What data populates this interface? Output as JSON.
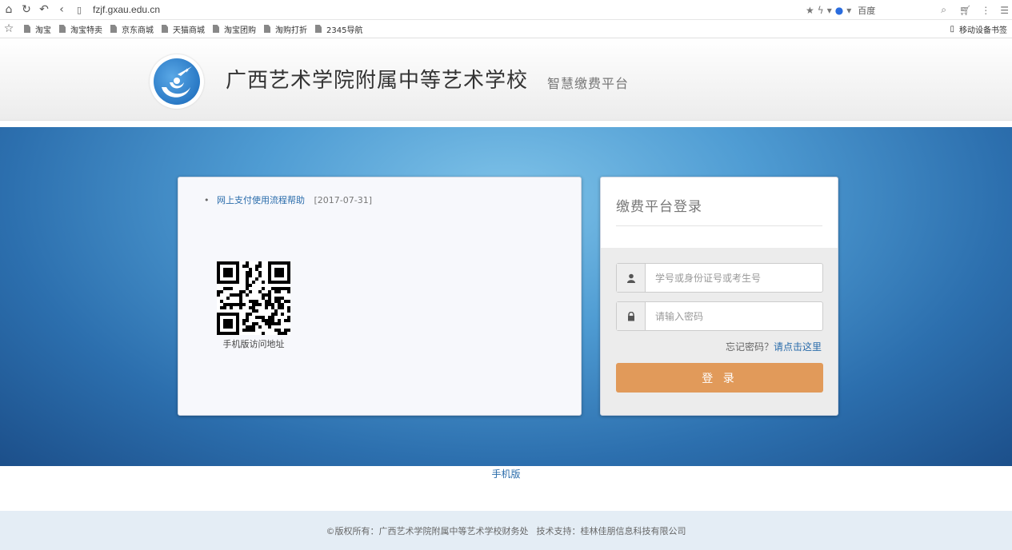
{
  "browser": {
    "url": "fzjf.gxau.edu.cn",
    "search_engine": "百度",
    "bookmarks": [
      "淘宝",
      "淘宝特卖",
      "京东商城",
      "天猫商城",
      "淘宝团购",
      "淘购打折",
      "2345导航"
    ],
    "mobile_bookmarks": "移动设备书签"
  },
  "header": {
    "school_name": "广西艺术学院附属中等艺术学校",
    "platform_name": "智慧缴费平台"
  },
  "news": {
    "items": [
      {
        "title": "网上支付使用流程帮助",
        "date": "[2017-07-31]"
      }
    ],
    "qr_caption": "手机版访问地址"
  },
  "login": {
    "title": "缴费平台登录",
    "username_placeholder": "学号或身份证号或考生号",
    "password_placeholder": "请输入密码",
    "forgot_text": "忘记密码？",
    "forgot_link": "请点击这里",
    "submit_label": "登 录"
  },
  "mobile_version": "手机版",
  "footer": {
    "copyright": "©版权所有：广西艺术学院附属中等艺术学校财务处",
    "support": "技术支持：桂林佳朋信息科技有限公司"
  }
}
